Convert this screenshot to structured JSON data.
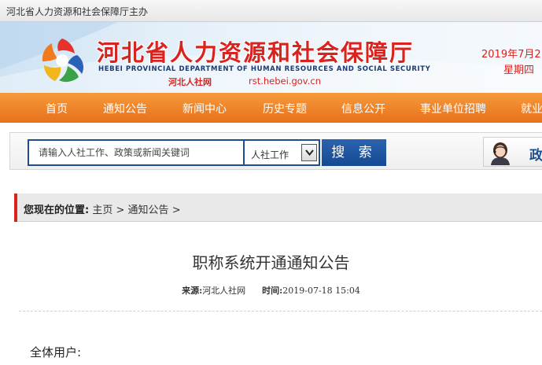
{
  "topbar": {
    "sponsor": "河北省人力资源和社会保障厅主办"
  },
  "header": {
    "title": "河北省人力资源和社会保障厅",
    "title_en": "HEBEI PROVINCIAL DEPARTMENT OF HUMAN RESOURCES AND SOCIAL SECURITY",
    "short_name": "河北人社网",
    "url": "rst.hebei.gov.cn",
    "date": "2019年7月2",
    "weekday": "星期四",
    "logo_icon": "star-logo-icon",
    "brand_red": "#d8231f"
  },
  "nav": {
    "color": "#e8711a",
    "items": [
      {
        "label": "首页"
      },
      {
        "label": "通知公告"
      },
      {
        "label": "新闻中心"
      },
      {
        "label": "历史专题"
      },
      {
        "label": "信息公开"
      },
      {
        "label": "事业单位招聘"
      },
      {
        "label": "就业"
      }
    ]
  },
  "search": {
    "placeholder": "请输入人社工作、政策或新闻关键词",
    "category_selected": "人社工作",
    "button_label": "搜 索",
    "accent": "#1d4e8f"
  },
  "service": {
    "label": "政",
    "avatar_icon": "customer-service-avatar-icon"
  },
  "breadcrumb": {
    "label": "您现在的位置:",
    "items": [
      {
        "label": "主页"
      },
      {
        "label": "通知公告"
      }
    ],
    "separator": ">"
  },
  "article": {
    "title": "职称系统开通通知公告",
    "source_label": "来源:",
    "source": "河北人社网",
    "time_label": "时间:",
    "time": "2019-07-18 15:04",
    "greeting": "全体用户:"
  }
}
